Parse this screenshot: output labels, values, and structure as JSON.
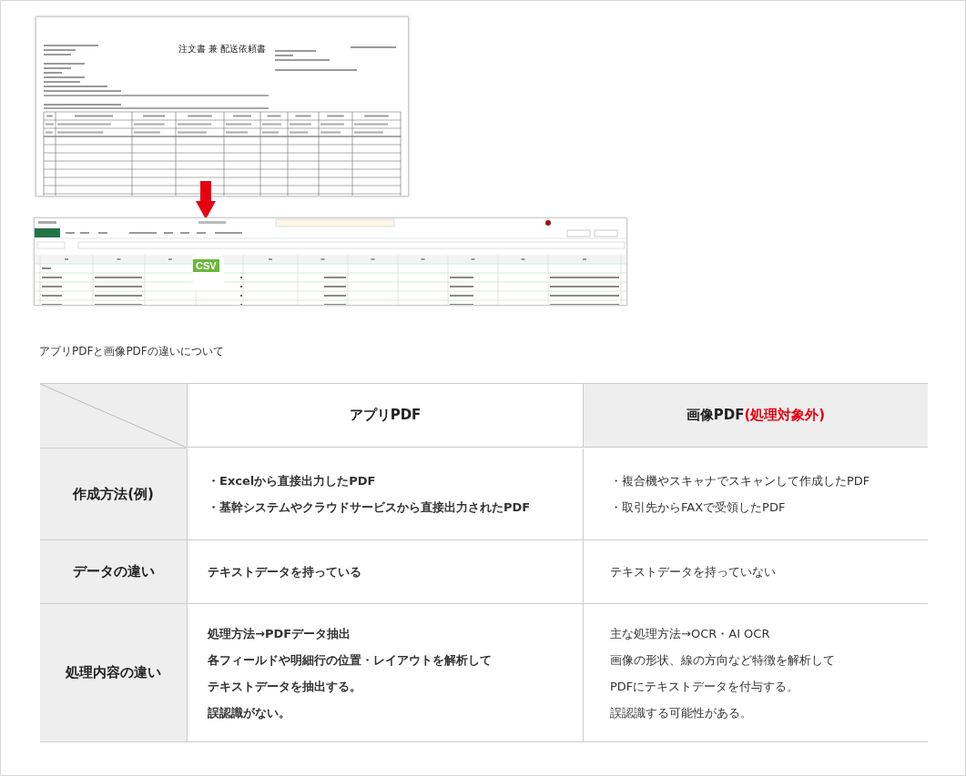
{
  "order_form": {
    "title": "注文書 兼 配送依頼書"
  },
  "spreadsheet": {
    "badge": "CSV"
  },
  "caption": "アプリPDFと画像PDFの違いについて",
  "comparison": {
    "columns": [
      {
        "title": "アプリPDF"
      },
      {
        "title": "画像PDF",
        "note": "(処理対象外)"
      }
    ],
    "rows": [
      {
        "label": "作成方法(例)",
        "app": [
          "・Excelから直接出力したPDF",
          "・基幹システムやクラウドサービスから直接出力されたPDF"
        ],
        "image": [
          "・複合機やスキャナでスキャンして作成したPDF",
          "・取引先からFAXで受領したPDF"
        ]
      },
      {
        "label": "データの違い",
        "app": [
          "テキストデータを持っている"
        ],
        "image": [
          "テキストデータを持っていない"
        ]
      },
      {
        "label": "処理内容の違い",
        "app": [
          "処理方法→PDFデータ抽出",
          "各フィールドや明細行の位置・レイアウトを解析して",
          "テキストデータを抽出する。",
          "誤認識がない。"
        ],
        "image": [
          "主な処理方法→OCR・AI OCR",
          "画像の形状、線の方向など特徴を解析して",
          "PDFにテキストデータを付与する。",
          "誤認識する可能性がある。"
        ]
      }
    ]
  }
}
